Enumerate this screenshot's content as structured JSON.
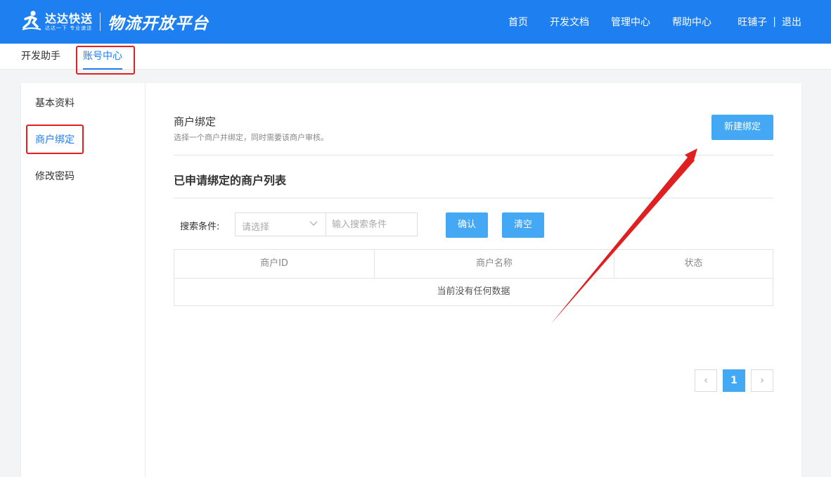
{
  "header": {
    "brand_name": "达达快送",
    "brand_slogan": "达达一下 专业速送",
    "platform_title": "物流开放平台",
    "nav": [
      "首页",
      "开发文档",
      "管理中心",
      "帮助中心"
    ],
    "username": "旺铺子",
    "separator": "|",
    "logout": "退出"
  },
  "subnav": {
    "items": [
      "开发助手",
      "账号中心"
    ],
    "active_index": 1
  },
  "sidebar": {
    "items": [
      "基本资料",
      "商户绑定",
      "修改密码"
    ],
    "active_index": 1
  },
  "section": {
    "title": "商户绑定",
    "description": "选择一个商户并绑定，同时需要该商户审核。",
    "new_button": "新建绑定"
  },
  "list": {
    "title": "已申请绑定的商户列表",
    "search_label": "搜索条件:",
    "select_placeholder": "请选择",
    "input_placeholder": "输入搜索条件",
    "confirm_button": "确认",
    "clear_button": "清空",
    "columns": [
      "商户ID",
      "商户名称",
      "状态"
    ],
    "empty_text": "当前没有任何数据"
  },
  "pagination": {
    "prev": "‹",
    "current": "1",
    "next": "›"
  },
  "icons": {
    "logo": "runner-logo-icon",
    "select_caret": "chevron-down-icon"
  },
  "colors": {
    "primary": "#1d7ff0",
    "button": "#45a8f5",
    "annotation": "#e02020"
  }
}
